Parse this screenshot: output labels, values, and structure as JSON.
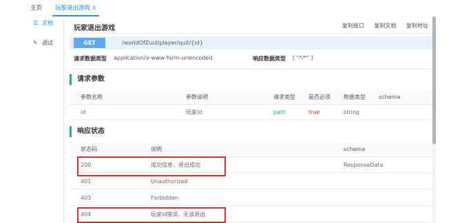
{
  "tabs": {
    "home": "主页",
    "active": "玩家退出游戏",
    "close": "X"
  },
  "sidebar": {
    "doc": {
      "icon": "☰",
      "label": "文档"
    },
    "debug": {
      "icon": "✎",
      "label": "调试"
    }
  },
  "header": {
    "title": "玩家退出游戏",
    "actions": [
      "复制接口",
      "复制文档",
      "复制地址"
    ]
  },
  "request": {
    "method": "GET",
    "path": "/worldOfZuul/player/quit/{id}",
    "req_type_label": "请求数据类型",
    "req_type_value": "application/x-www-form-urlencoded",
    "resp_type_label": "响应数据类型",
    "resp_type_value": "[ \"*/*\" ]"
  },
  "params": {
    "section_title": "请求参数",
    "headers": [
      "参数名称",
      "参数说明",
      "请求类型",
      "是否必须",
      "数据类型",
      "schema"
    ],
    "rows": [
      [
        "id",
        "玩家Id",
        "path",
        "true",
        "string",
        ""
      ]
    ]
  },
  "responses": {
    "section_title": "响应状态",
    "headers": [
      "状态码",
      "说明",
      "schema"
    ],
    "rows": [
      [
        "200",
        "成功信息，退出成功",
        "ResponseData"
      ],
      [
        "401",
        "Unauthorized",
        ""
      ],
      [
        "403",
        "Forbidden",
        ""
      ],
      [
        "404",
        "玩家id错误，无该退出",
        ""
      ]
    ]
  },
  "colors": {
    "accent": "#1890ff",
    "method_bg": "#5fa8f5",
    "section_bar": "#1ab394",
    "highlight": "#e12b2b"
  }
}
